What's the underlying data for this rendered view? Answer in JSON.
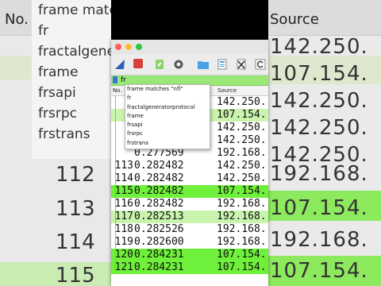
{
  "background": {
    "left_header": "No.",
    "right_header": "Source",
    "left_menu": [
      "frame matches",
      "fr",
      "fractalgene",
      "frame",
      "frsapi",
      "frsrpc",
      "frstrans"
    ],
    "left_numbers": [
      "112",
      "113",
      "114",
      "115"
    ],
    "right_values": [
      "142.250.",
      "107.154.",
      "142.250.",
      "142.250.",
      "142.250.",
      "192.168.",
      "142.250.",
      "107.154.",
      "192.168.",
      "142.250.",
      "107.154."
    ]
  },
  "window": {
    "filter_text": "fr",
    "columns": {
      "no": "No.",
      "source": "Source"
    },
    "autocomplete": [
      "frame matches \"nfl\"",
      "fr",
      "fractalgeneratorprotocol",
      "frame",
      "frsapi",
      "frsrpc",
      "frstrans"
    ],
    "rows": [
      {
        "no": "",
        "time": "",
        "src": "142.250.",
        "hl": false
      },
      {
        "no": "",
        "time": "",
        "src": "107.154.",
        "hl": true
      },
      {
        "no": "",
        "time": "",
        "src": "142.250.",
        "hl": false
      },
      {
        "no": "",
        "time": "",
        "src": "142.250.",
        "hl": false
      },
      {
        "no": "",
        "time": "0.277569",
        "src": "192.168.",
        "hl": false
      },
      {
        "no": "113",
        "time": "0.282482",
        "src": "142.250.",
        "hl": false
      },
      {
        "no": "114",
        "time": "0.282482",
        "src": "142.250.",
        "hl": false
      },
      {
        "no": "115",
        "time": "0.282482",
        "src": "107.154.",
        "hl": "bright"
      },
      {
        "no": "116",
        "time": "0.282482",
        "src": "192.168.",
        "hl": false
      },
      {
        "no": "117",
        "time": "0.282513",
        "src": "192.168.",
        "hl": true
      },
      {
        "no": "118",
        "time": "0.282526",
        "src": "192.168.",
        "hl": false
      },
      {
        "no": "119",
        "time": "0.282600",
        "src": "192.168.",
        "hl": false
      },
      {
        "no": "120",
        "time": "0.284231",
        "src": "107.154.",
        "hl": "bright"
      },
      {
        "no": "121",
        "time": "0.284231",
        "src": "107.154.",
        "hl": "bright"
      }
    ]
  },
  "colors": {
    "highlight_green": "#c9f4ad",
    "bright_green": "#6ff03a",
    "filter_green": "#9be879"
  }
}
